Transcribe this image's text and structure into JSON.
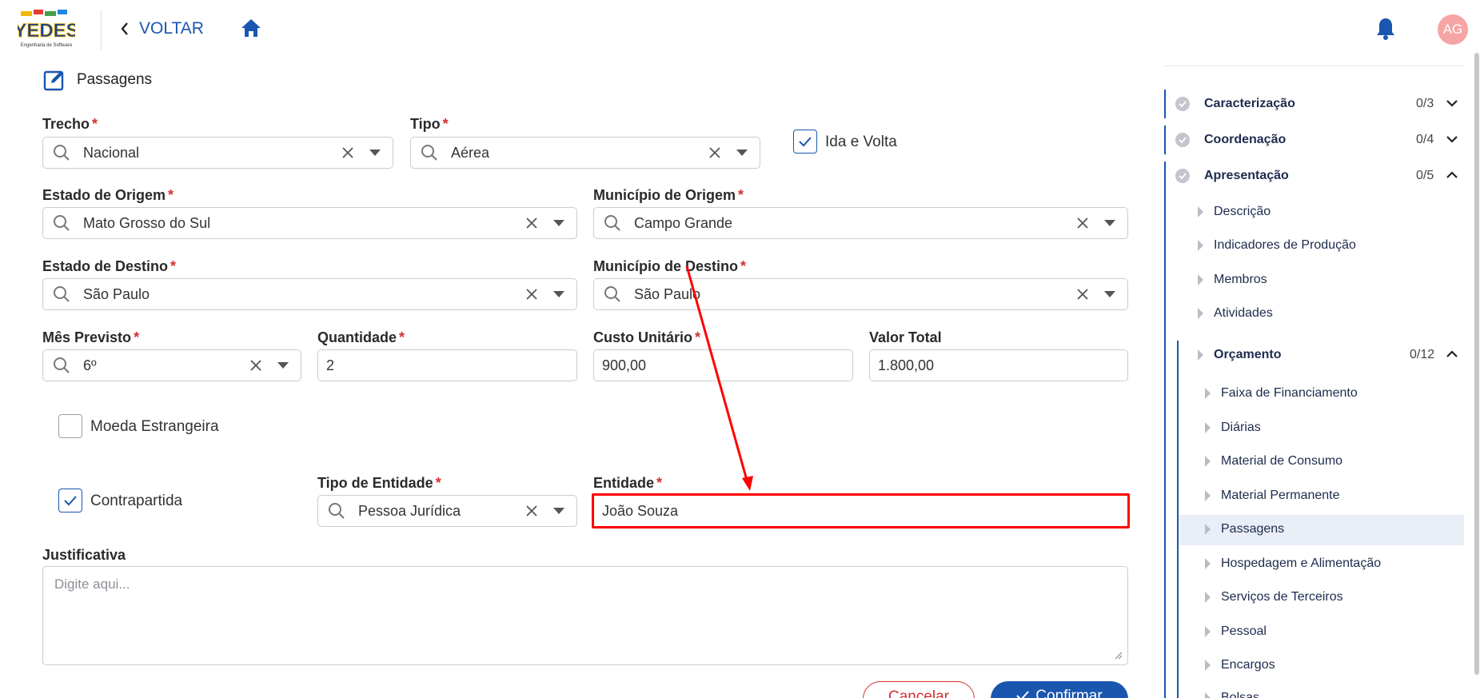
{
  "header": {
    "logo_text": "YEDES",
    "logo_subtitle": "Engenharia de Software",
    "back_label": "VOLTAR",
    "avatar_initials": "AG"
  },
  "form": {
    "section_title": "Passagens",
    "trecho": {
      "label": "Trecho",
      "value": "Nacional"
    },
    "tipo": {
      "label": "Tipo",
      "value": "Aérea"
    },
    "ida_volta": {
      "label": "Ida e Volta",
      "checked": true
    },
    "estado_origem": {
      "label": "Estado de Origem",
      "value": "Mato Grosso do Sul"
    },
    "municipio_origem": {
      "label": "Município de Origem",
      "value": "Campo Grande"
    },
    "estado_destino": {
      "label": "Estado de Destino",
      "value": "São Paulo"
    },
    "municipio_destino": {
      "label": "Município de Destino",
      "value": "São Paulo"
    },
    "mes_previsto": {
      "label": "Mês Previsto",
      "value": "6º"
    },
    "quantidade": {
      "label": "Quantidade",
      "value": "2"
    },
    "custo_unitario": {
      "label": "Custo Unitário",
      "value": "900,00"
    },
    "valor_total": {
      "label": "Valor Total",
      "value": "1.800,00"
    },
    "moeda_estrangeira": {
      "label": "Moeda Estrangeira",
      "checked": false
    },
    "contrapartida": {
      "label": "Contrapartida",
      "checked": true
    },
    "tipo_entidade": {
      "label": "Tipo de Entidade",
      "value": "Pessoa Jurídica"
    },
    "entidade": {
      "label": "Entidade",
      "value": "João Souza"
    },
    "justificativa": {
      "label": "Justificativa",
      "placeholder": "Digite aqui..."
    },
    "required_mark": "*",
    "cancel_label": "Cancelar",
    "confirm_label": "Confirmar"
  },
  "sidebar": {
    "sections": [
      {
        "label": "Caracterização",
        "count": "0/3"
      },
      {
        "label": "Coordenação",
        "count": "0/4"
      },
      {
        "label": "Apresentação",
        "count": "0/5"
      }
    ],
    "apresentacao_items": [
      "Descrição",
      "Indicadores de Produção",
      "Membros",
      "Atividades"
    ],
    "orcamento": {
      "label": "Orçamento",
      "count": "0/12"
    },
    "orcamento_items": [
      "Faixa de Financiamento",
      "Diárias",
      "Material de Consumo",
      "Material Permanente",
      "Passagens",
      "Hospedagem e Alimentação",
      "Serviços de Terceiros",
      "Pessoal",
      "Encargos",
      "Bolsas"
    ],
    "active_item": "Passagens"
  },
  "colors": {
    "primary": "#1a56b0",
    "required": "#d32f2f",
    "highlight": "#ff0000",
    "avatar": "#f7a4a4"
  }
}
